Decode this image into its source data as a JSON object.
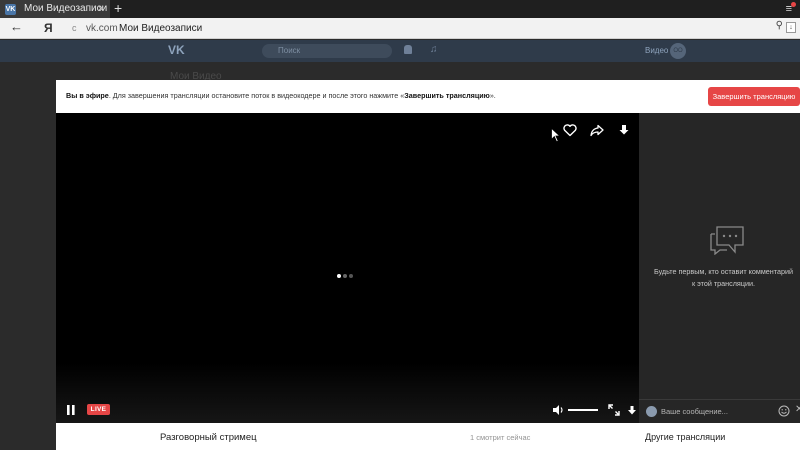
{
  "browser": {
    "tab_title": "Мои Видеозаписи",
    "tab_favicon": "VK",
    "tab_close": "×",
    "new_tab": "+",
    "menu_icon": "≡",
    "back_icon": "←",
    "yandex_icon": "Я",
    "address_host": "vk.com",
    "address_title": "Мои Видеозаписи"
  },
  "vk_header": {
    "logo": "VK",
    "search_placeholder": "Поиск",
    "user_name": "Видео",
    "avatar_initials": "ОО",
    "behind_title": "Мои Видео"
  },
  "banner": {
    "bold_lead": "Вы в эфире",
    "text": ". Для завершения трансляции остановите поток в видеокодере и после этого нажмите «",
    "bold_action": "Завершить трансляцию",
    "text_end": "».",
    "end_button": "Завершить трансляцию"
  },
  "player": {
    "live_label": "LIVE",
    "icons": [
      "like-icon",
      "share-icon",
      "download-icon",
      "pause-icon",
      "volume-icon",
      "fullscreen-icon",
      "arrow-cursor-icon"
    ],
    "volume_level": 1.0
  },
  "chat": {
    "empty_text_line1": "Будьте первым, кто оставит комментарий",
    "empty_text_line2": "к этой трансляции.",
    "input_placeholder": "Ваше сообщение...",
    "close_icon": "✕"
  },
  "info": {
    "video_title": "Разговорный стримец",
    "viewers": "1 смотрит сейчас",
    "other_streams": "Другие трансляции"
  },
  "colors": {
    "accent_red": "#e64646",
    "player_bg": "#000000",
    "chat_bg": "#262626"
  }
}
